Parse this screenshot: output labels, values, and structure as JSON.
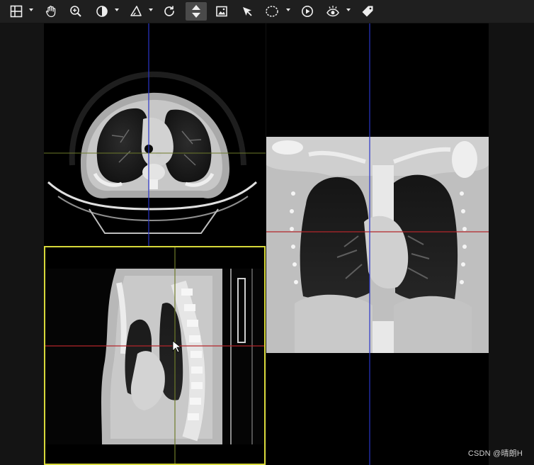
{
  "toolbar": {
    "tools": [
      {
        "name": "layout-icon",
        "has_menu": true,
        "active": false
      },
      {
        "name": "pan-hand-icon",
        "has_menu": false,
        "active": false
      },
      {
        "name": "zoom-icon",
        "has_menu": false,
        "active": false
      },
      {
        "name": "window-level-icon",
        "has_menu": true,
        "active": false
      },
      {
        "name": "measure-angle-icon",
        "has_menu": true,
        "active": false
      },
      {
        "name": "reset-rotate-icon",
        "has_menu": false,
        "active": false
      },
      {
        "name": "scroll-stack-icon",
        "has_menu": false,
        "active": true
      },
      {
        "name": "image-icon",
        "has_menu": false,
        "active": false
      },
      {
        "name": "pointer-icon",
        "has_menu": false,
        "active": false
      },
      {
        "name": "roi-ellipse-icon",
        "has_menu": true,
        "active": false
      },
      {
        "name": "cine-play-icon",
        "has_menu": false,
        "active": false
      },
      {
        "name": "visibility-eye-icon",
        "has_menu": true,
        "active": false
      },
      {
        "name": "tag-icon",
        "has_menu": false,
        "active": false
      }
    ]
  },
  "viewports": {
    "axial": {
      "name": "axial-viewport",
      "active": false
    },
    "coronal": {
      "name": "coronal-viewport",
      "active": false
    },
    "sagittal": {
      "name": "sagittal-viewport",
      "active": true
    }
  },
  "colors": {
    "active_border": "#d7d83a",
    "crosshair_blue": "#2a35c8",
    "crosshair_red": "#b3262b",
    "crosshair_green": "#6d7a2a"
  },
  "watermark": "CSDN @晴朗H"
}
